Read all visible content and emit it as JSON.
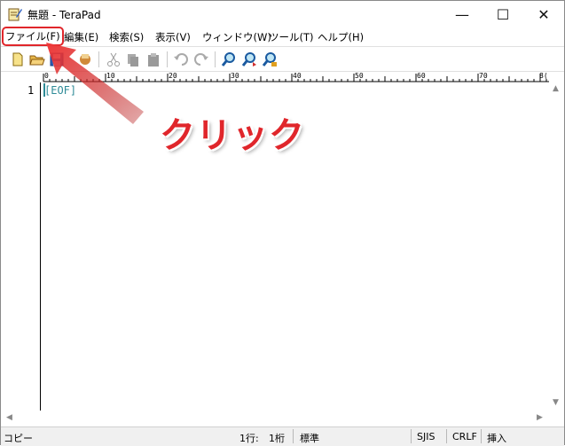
{
  "window": {
    "title": "無題 - TeraPad",
    "minimize_glyph": "—",
    "maximize_glyph": "☐",
    "close_glyph": "✕"
  },
  "menu": {
    "items": [
      {
        "label": "ファイル(F)"
      },
      {
        "label": "編集(E)"
      },
      {
        "label": "検索(S)"
      },
      {
        "label": "表示(V)"
      },
      {
        "label": "ウィンドウ(W)"
      },
      {
        "label": "ツール(T)"
      },
      {
        "label": "ヘルプ(H)"
      }
    ]
  },
  "toolbar": {
    "icons": [
      "new-file-icon",
      "open-folder-icon",
      "save-icon",
      "print-icon",
      "cut-icon",
      "copy-icon",
      "paste-icon",
      "undo-icon",
      "redo-icon",
      "search-icon",
      "search-next-icon",
      "replace-icon"
    ]
  },
  "ruler": {
    "labels": [
      "0",
      "10",
      "20",
      "30",
      "40",
      "50",
      "60",
      "70",
      "8("
    ]
  },
  "editor": {
    "line_number": "1",
    "content": "[EOF]"
  },
  "statusbar": {
    "mode": "コピー",
    "line": "1行:",
    "column": "1桁",
    "style": "標準",
    "encoding": "SJIS",
    "line_ending": "CRLF",
    "insert_mode": "挿入"
  },
  "annotation": {
    "text": "クリック",
    "color": "#e0262b"
  },
  "colors": {
    "eof": "#2e8b97",
    "highlight": "#e0262b"
  }
}
